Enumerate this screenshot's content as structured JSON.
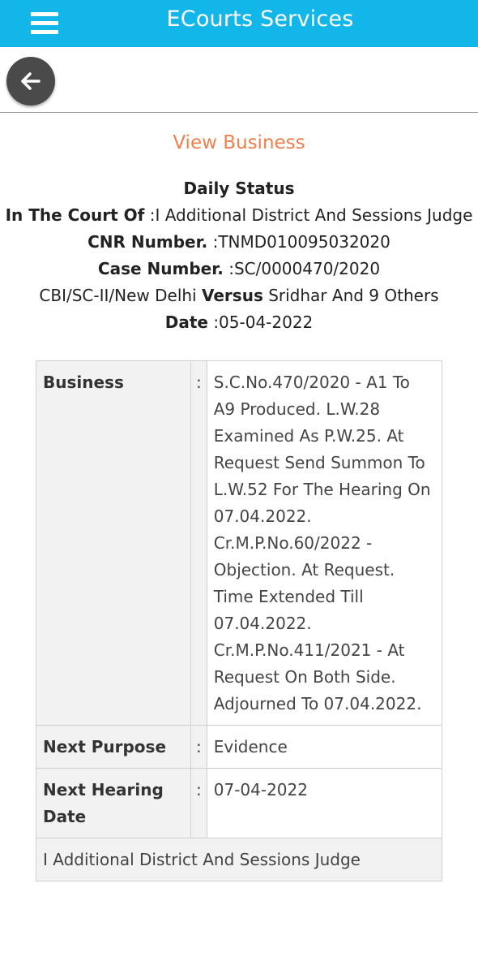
{
  "appbar": {
    "title": "ECourts Services",
    "menu_icon": "hamburger-menu-icon",
    "color": "#12b6e8"
  },
  "nav": {
    "back_icon": "arrow-left-icon"
  },
  "page": {
    "heading": "View Business",
    "heading_color": "#ef7f4d"
  },
  "case_info": {
    "status_title": "Daily Status",
    "court_label": "In The Court Of",
    "court_value": ":I Additional District And Sessions Judge",
    "cnr_label": "CNR Number.",
    "cnr_value": ":TNMD010095032020",
    "case_label": "Case Number.",
    "case_value": ":SC/0000470/2020",
    "petitioner": "CBI/SC-II/New Delhi",
    "versus_label": "Versus",
    "respondent": "Sridhar And 9 Others",
    "date_label": "Date",
    "date_value": ":05-04-2022"
  },
  "table": {
    "separator": ":",
    "business_label": "Business",
    "business_value": "S.C.No.470/2020 - A1 To A9 Produced. L.W.28 Examined As P.W.25. At Request Send Summon To L.W.52 For The Hearing On 07.04.2022. Cr.M.P.No.60/2022 - Objection. At Request. Time Extended Till 07.04.2022. Cr.M.P.No.411/2021 - At Request On Both Side. Adjourned To 07.04.2022.",
    "purpose_label": "Next Purpose",
    "purpose_value": "Evidence",
    "hearing_label": "Next Hearing Date",
    "hearing_value": "07-04-2022",
    "footer": "I Additional District And Sessions Judge"
  }
}
